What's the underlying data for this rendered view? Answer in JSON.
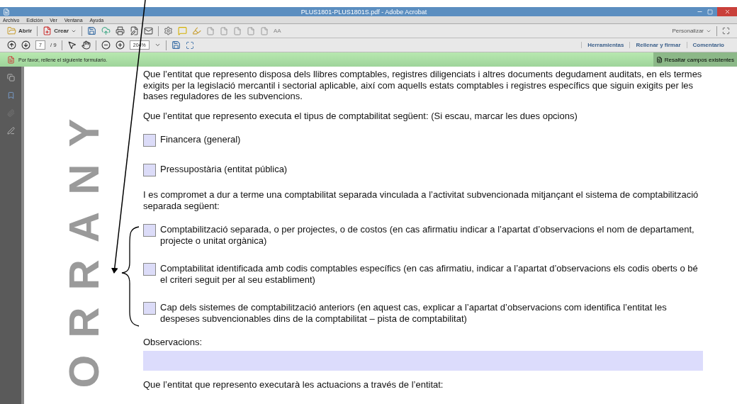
{
  "window": {
    "title": "PLUS1801-PLUS1801S.pdf - Adobe Acrobat"
  },
  "menu": [
    "Archivo",
    "Edición",
    "Ver",
    "Ventana",
    "Ayuda"
  ],
  "toolbar": {
    "open": "Abrir",
    "create": "Crear",
    "font_size": "AA",
    "customize": "Personalizar"
  },
  "nav": {
    "page": "7",
    "pages": "/ 9",
    "zoom": "204%"
  },
  "panes": [
    {
      "label": "Herramientas"
    },
    {
      "label": "Rellenar y firmar"
    },
    {
      "label": "Comentario"
    }
  ],
  "form_bar": {
    "message": "Por favor, rellene el siguiente formulario.",
    "button": "Resaltar campos existentes"
  },
  "watermark": "ORRANY",
  "document": [
    {
      "kind": "paragraph",
      "text": "Que l’entitat que represento disposa dels llibres comptables, registres diligenciats i altres documents degudament auditats, en els termes exigits per la legislació mercantil i sectorial aplicable, així com aquells estats comptables i registres específics que siguin exigits per les bases reguladores de les subvencions."
    },
    {
      "kind": "paragraph",
      "text": "Que l’entitat que represento executa el tipus de comptabilitat següent: (Si escau, marcar les dues opcions)"
    },
    {
      "kind": "checkbox",
      "text": "Financera (general)",
      "checked": false
    },
    {
      "kind": "checkbox",
      "text": "Pressupostària (entitat pública)",
      "checked": false
    },
    {
      "kind": "paragraph",
      "text": "I es compromet a dur a terme una comptabilitat separada vinculada a l’activitat subvencionada mitjançant el sistema de comptabilització separada següent:"
    },
    {
      "kind": "checkbox",
      "text": "Comptabilització separada, o per projectes, o de costos (en cas afirmatiu indicar a l’apartat d’observacions el nom de departament, projecte o unitat orgànica)",
      "checked": false
    },
    {
      "kind": "checkbox",
      "text": "Comptabilitat identificada amb codis comptables específics (en cas afirmatiu, indicar a l’apartat d’observacions els codis oberts o bé el criteri seguit per al seu establiment)",
      "checked": false
    },
    {
      "kind": "checkbox",
      "text": "Cap dels sistemes de comptabilització anteriors (en aquest cas, explicar a l’apartat d’observacions com identifica l’entitat les despeses subvencionables dins de la comptabilitat – pista de comptabilitat)",
      "checked": false
    },
    {
      "kind": "field",
      "text": "Observacions:"
    },
    {
      "kind": "paragraph",
      "text": "Que l’entitat que represento executarà les actuacions a través de l’entitat:"
    }
  ]
}
